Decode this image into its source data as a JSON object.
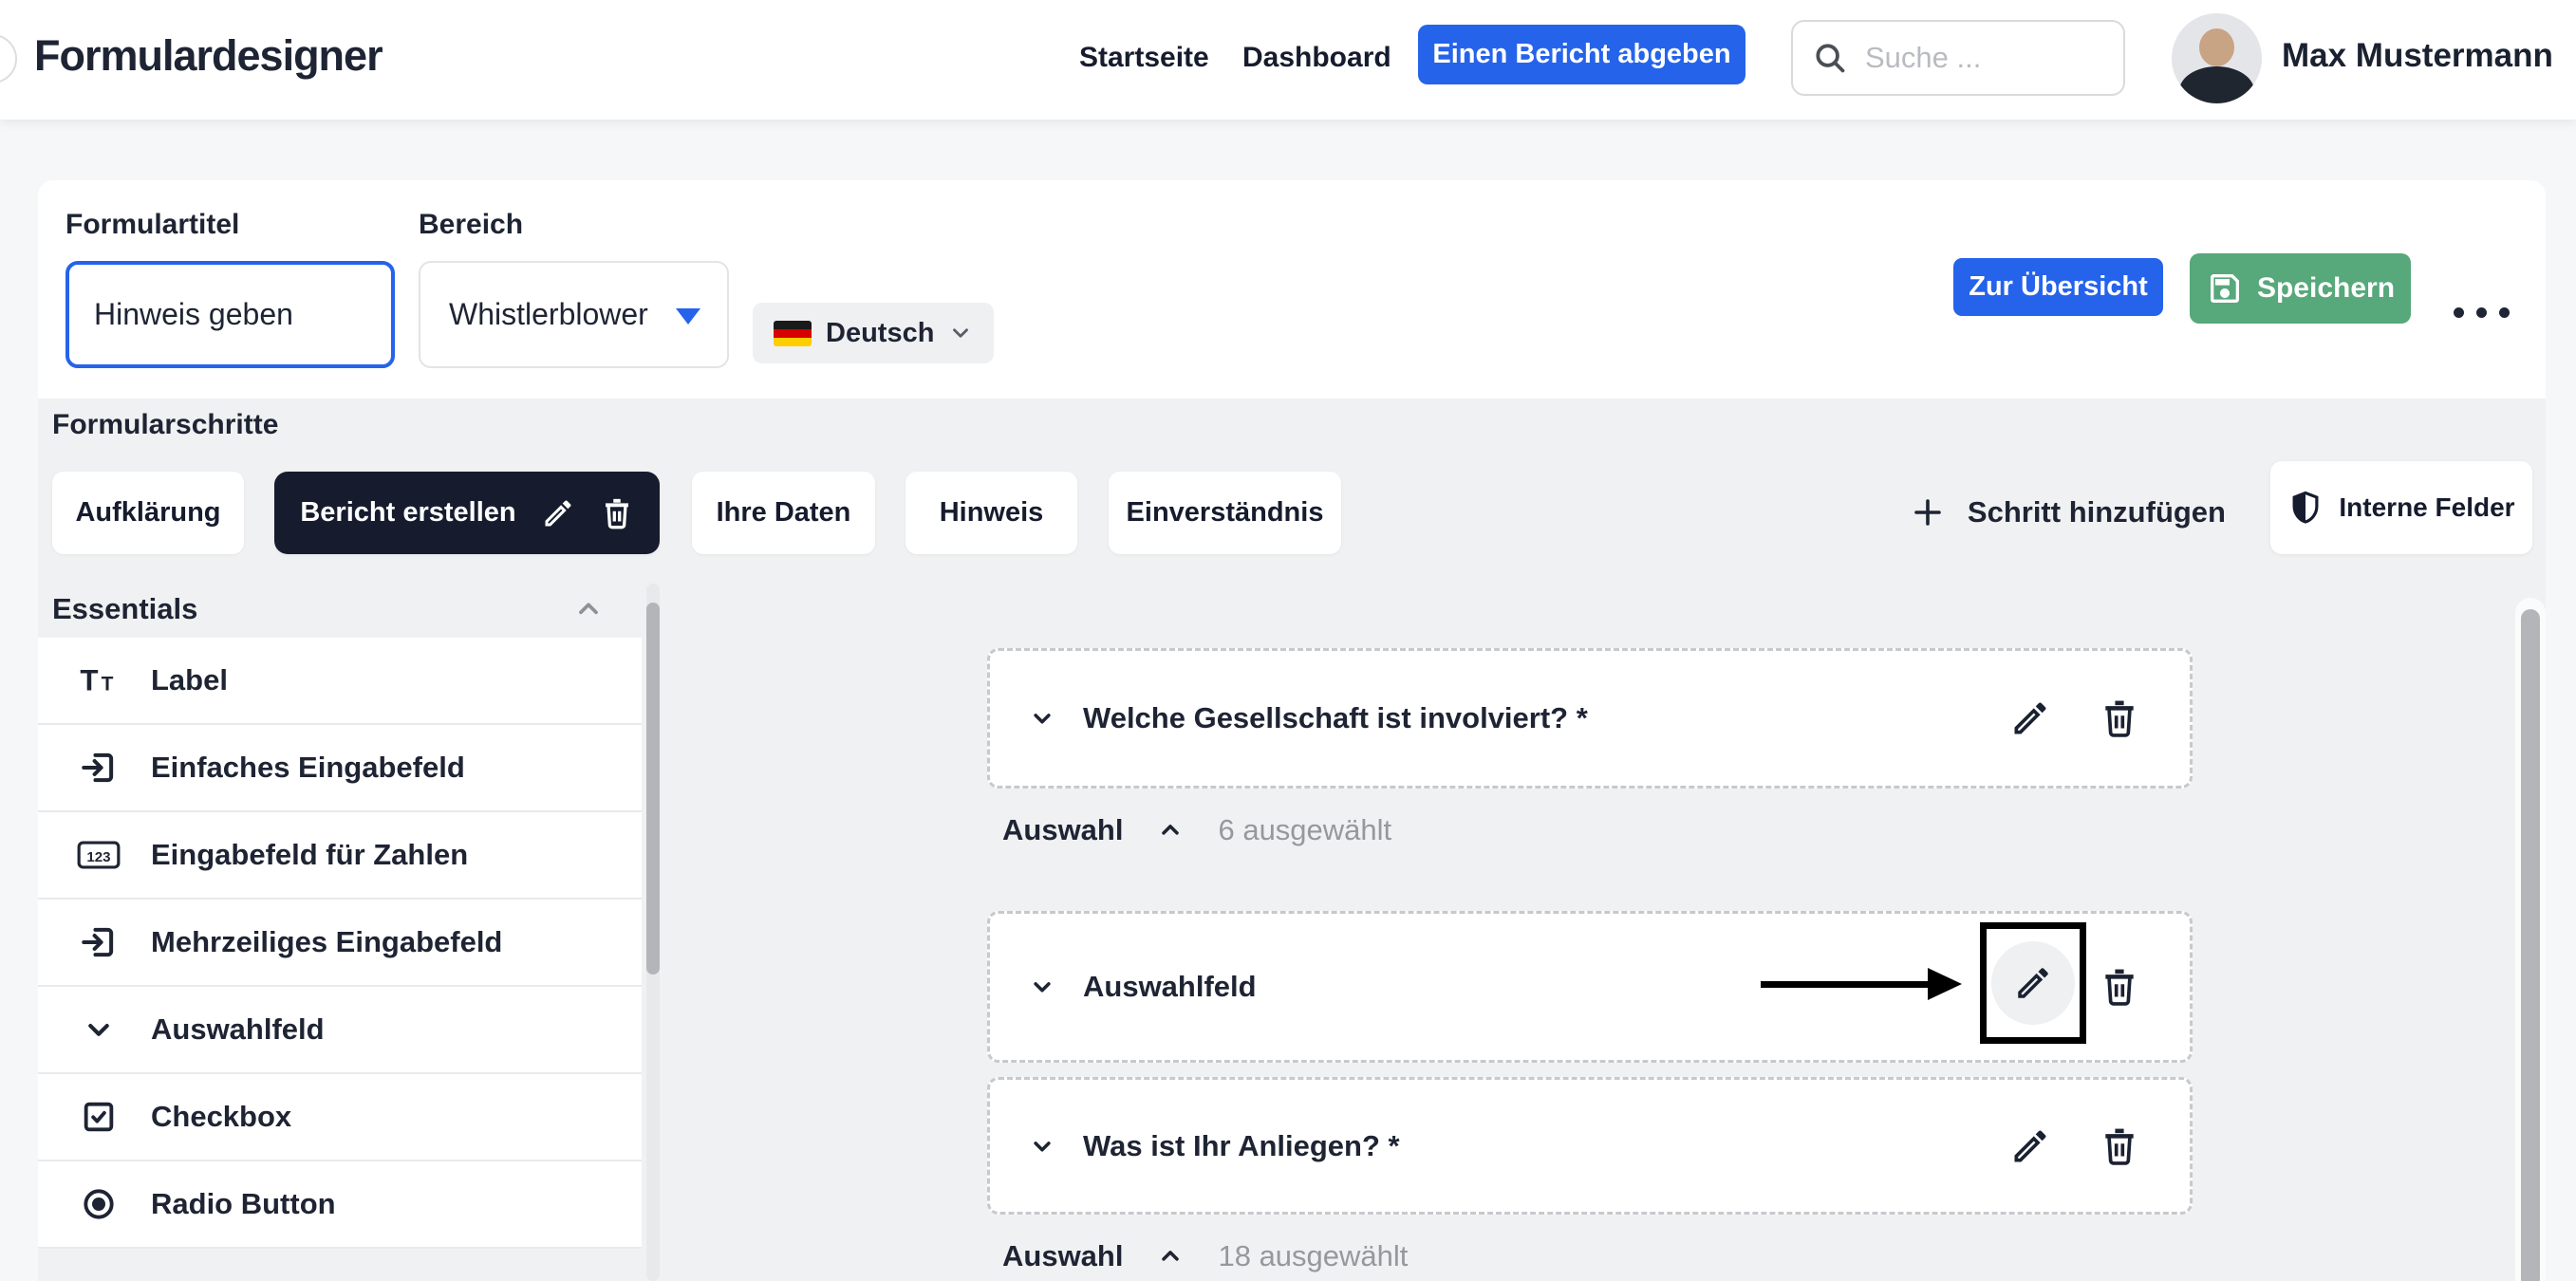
{
  "header": {
    "app_title": "Formulardesigner",
    "nav": [
      {
        "label": "Startseite"
      },
      {
        "label": "Dashboard"
      }
    ],
    "report_button_label": "Einen Bericht abgeben",
    "search_placeholder": "Suche ...",
    "user_name": "Max Mustermann"
  },
  "form_meta": {
    "title_label": "Formulartitel",
    "title_value": "Hinweis geben",
    "area_label": "Bereich",
    "area_value": "Whistlerblower",
    "language_value": "Deutsch"
  },
  "actions": {
    "overview_button_label": "Zur Übersicht",
    "save_button_label": "Speichern"
  },
  "steps": {
    "section_label": "Formularschritte",
    "tabs": [
      {
        "label": "Aufklärung",
        "active": false
      },
      {
        "label": "Bericht erstellen",
        "active": true
      },
      {
        "label": "Ihre Daten",
        "active": false
      },
      {
        "label": "Hinweis",
        "active": false
      },
      {
        "label": "Einverständnis",
        "active": false
      }
    ],
    "add_step_label": "Schritt hinzufügen",
    "internal_fields_label": "Interne Felder"
  },
  "palette": {
    "group_label": "Essentials",
    "items": [
      {
        "label": "Label",
        "icon": "text-style-icon"
      },
      {
        "label": "Einfaches Eingabefeld",
        "icon": "input-arrow-icon"
      },
      {
        "label": "Eingabefeld für Zahlen",
        "icon": "number-123-icon"
      },
      {
        "label": "Mehrzeiliges Eingabefeld",
        "icon": "input-arrow-icon"
      },
      {
        "label": "Auswahlfeld",
        "icon": "chevron-down-icon"
      },
      {
        "label": "Checkbox",
        "icon": "checkbox-icon"
      },
      {
        "label": "Radio Button",
        "icon": "radio-icon"
      }
    ]
  },
  "canvas": {
    "fields": [
      {
        "label": "Welche Gesellschaft ist involviert? *",
        "meta_label": "Auswahl",
        "meta_count": "6 ausgewählt",
        "highlighted": false
      },
      {
        "label": "Auswahlfeld",
        "highlighted": true
      },
      {
        "label": "Was ist Ihr Anliegen? *",
        "meta_label": "Auswahl",
        "meta_count": "18 ausgewählt",
        "highlighted": false
      }
    ]
  },
  "colors": {
    "accent_blue": "#2563eb",
    "save_green": "#57a87a",
    "dark_navy": "#161c2e",
    "text_dark": "#1e2433",
    "text_gray": "#95989d",
    "page_gray": "#f0f1f2",
    "annotation_black": "#000000"
  }
}
